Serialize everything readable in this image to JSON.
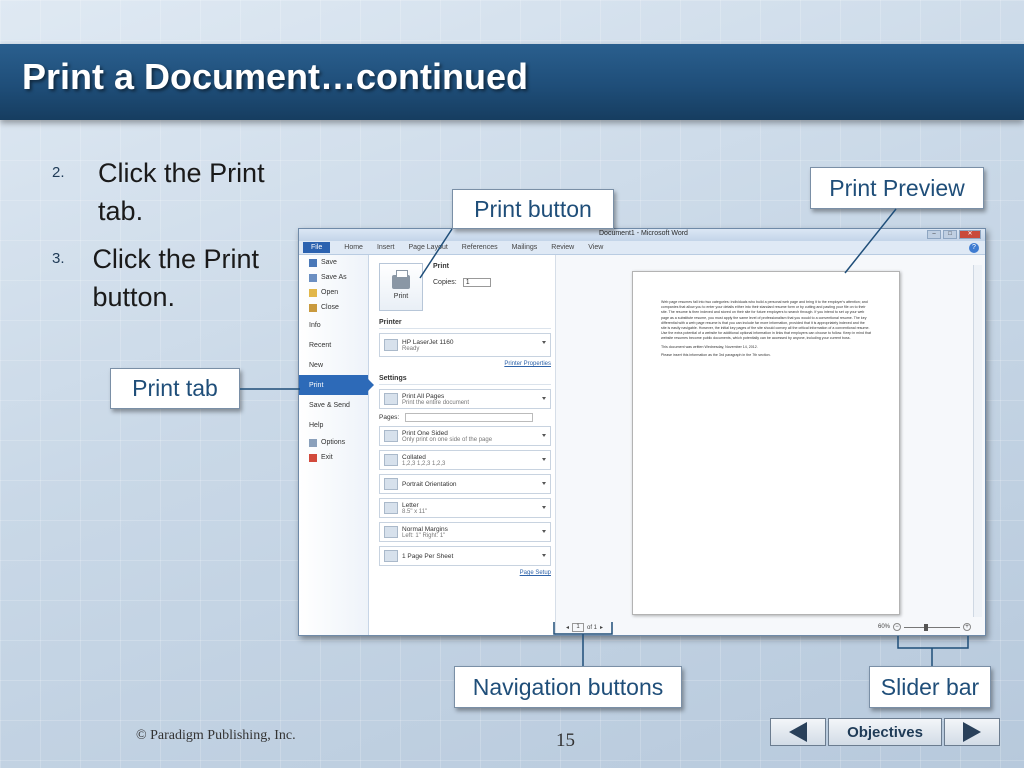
{
  "slide": {
    "title": "Print a Document…continued",
    "steps": [
      {
        "num": "2.",
        "text": "Click the Print tab."
      },
      {
        "num": "3.",
        "text": "Click the Print button."
      }
    ],
    "callouts": {
      "print_tab": "Print tab",
      "print_button": "Print button",
      "print_preview": "Print Preview",
      "navigation_buttons": "Navigation buttons",
      "slider_bar": "Slider bar"
    },
    "footer": {
      "copyright": "© Paradigm Publishing, Inc.",
      "page_number": "15",
      "objectives_label": "Objectives"
    }
  },
  "word": {
    "window_title": "Document1 - Microsoft Word",
    "tabs": [
      "File",
      "Home",
      "Insert",
      "Page Layout",
      "References",
      "Mailings",
      "Review",
      "View"
    ],
    "nav": {
      "commands_top": [
        "Save",
        "Save As",
        "Open",
        "Close"
      ],
      "groups": [
        "Info",
        "Recent",
        "New",
        "Print",
        "Save & Send",
        "Help"
      ],
      "commands_bottom": [
        "Options",
        "Exit"
      ]
    },
    "print": {
      "heading": "Print",
      "button_label": "Print",
      "copies_label": "Copies:",
      "copies_value": "1",
      "printer_heading": "Printer",
      "printer_name": "HP LaserJet 1160",
      "printer_status": "Ready",
      "printer_properties": "Printer Properties",
      "settings_heading": "Settings",
      "settings": [
        {
          "main": "Print All Pages",
          "sub": "Print the entire document"
        },
        {
          "main": "Print One Sided",
          "sub": "Only print on one side of the page"
        },
        {
          "main": "Collated",
          "sub": "1,2,3   1,2,3   1,2,3"
        },
        {
          "main": "Portrait Orientation",
          "sub": ""
        },
        {
          "main": "Letter",
          "sub": "8.5\" x 11\""
        },
        {
          "main": "Normal Margins",
          "sub": "Left: 1\"   Right: 1\""
        },
        {
          "main": "1 Page Per Sheet",
          "sub": ""
        }
      ],
      "pages_label": "Pages:",
      "page_setup": "Page Setup"
    },
    "preview": {
      "paragraphs": [
        "Web page resumes fall into two categories: individuals who build a personal web page and bring it to the employer's attention; and companies that allow you to enter your details either into their standard resume form or by cutting and pasting your file on to their site. The resume is then indexed and stored on their site for future employers to search through. If you intend to set up your web page as a substitute resume, you must apply the same level of professionalism that you would to a conventional resume. The key differential with a web page resume is that you can include far more information, provided that it is appropriately indexed and the site is easily navigable. However, the initial key pages of the site should convey all the critical information of a conventional resume. Use the extra potential of a website for additional optional information in links that employers can choose to follow. Keep in mind that website resumes become public documents, which potentially can be accessed by anyone, including your current boss.",
        "This document was written Wednesday, November 14, 2012.",
        "Please insert this information as the 3rd paragraph in the 7th section."
      ],
      "page_current": "1",
      "page_total": "of 1",
      "zoom": "60%"
    }
  }
}
